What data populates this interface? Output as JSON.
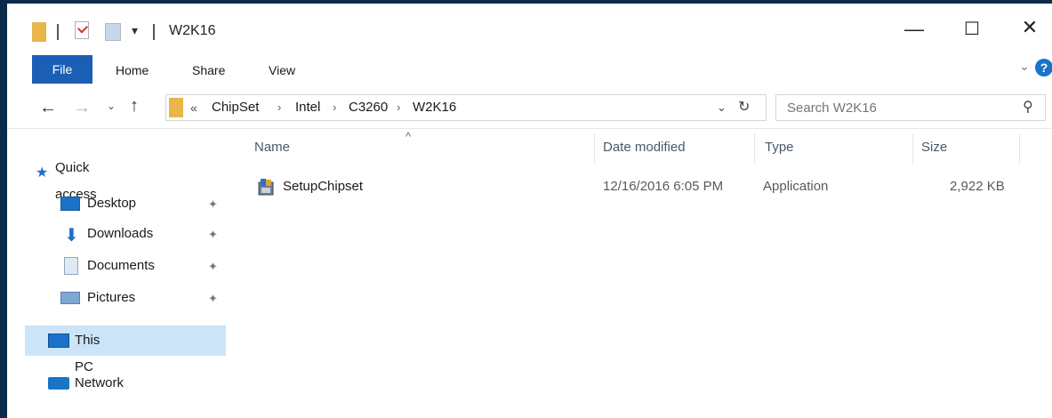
{
  "window": {
    "title": "W2K16",
    "quick_access_dropdown": "▾",
    "minimize": "—",
    "maximize": "☐",
    "close": "✕"
  },
  "ribbon": {
    "tabs": [
      "File",
      "Home",
      "Share",
      "View"
    ],
    "collapse": "⌄",
    "help": "?"
  },
  "navigation": {
    "back": "←",
    "forward": "→",
    "recent": "⌄",
    "up": "↑",
    "breadcrumb_overflow": "«",
    "breadcrumb": [
      "ChipSet",
      "Intel",
      "C3260",
      "W2K16"
    ],
    "separator": "›",
    "address_dropdown": "⌄",
    "refresh": "↻",
    "search_placeholder": "Search W2K16"
  },
  "nav_pane": {
    "quick_access": "Quick access",
    "items": [
      {
        "label": "Desktop",
        "icon": "desktop-icon",
        "pinned": true
      },
      {
        "label": "Downloads",
        "icon": "downloads-icon",
        "pinned": true
      },
      {
        "label": "Documents",
        "icon": "documents-icon",
        "pinned": true
      },
      {
        "label": "Pictures",
        "icon": "pictures-icon",
        "pinned": true
      }
    ],
    "this_pc": "This PC",
    "network": "Network",
    "pin_glyph": "📌"
  },
  "file_list": {
    "columns": [
      "Name",
      "Date modified",
      "Type",
      "Size"
    ],
    "sort_indicator": "^",
    "rows": [
      {
        "name": "SetupChipset",
        "date_modified": "12/16/2016 6:05 PM",
        "type": "Application",
        "size": "2,922 KB"
      }
    ]
  },
  "colors": {
    "accent": "#1a5fb4",
    "selection": "#cce4f7",
    "folder": "#e8b64a"
  }
}
